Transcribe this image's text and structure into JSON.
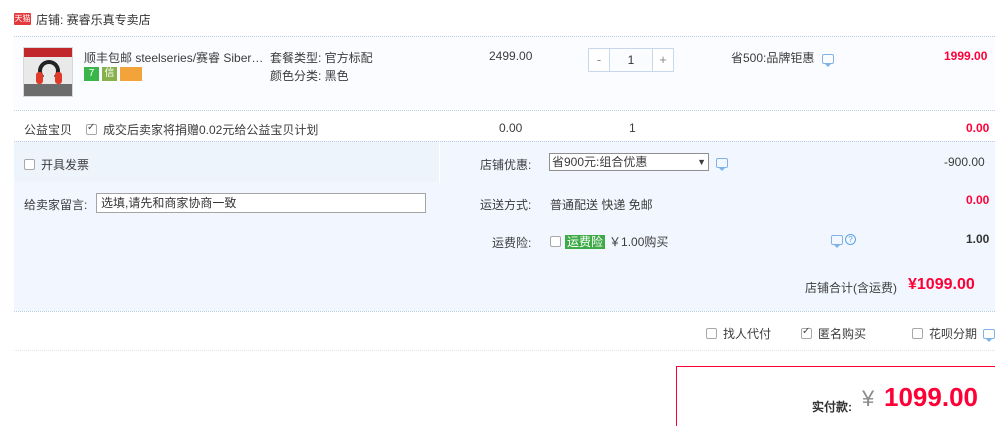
{
  "shop": {
    "badge": "天猫",
    "label": "店铺: 赛睿乐真专卖店"
  },
  "item": {
    "title": "顺丰包邮 steelseries/赛睿 Siberi...",
    "attr_package": "套餐类型: 官方标配",
    "attr_color": "颜色分类: 黑色",
    "unit_price": "2499.00",
    "quantity": "1",
    "minus": "-",
    "plus": "+",
    "promo": "省500:品牌钜惠",
    "subtotal": "1999.00",
    "icons": [
      "7",
      "信",
      ""
    ]
  },
  "charity": {
    "label": "公益宝贝",
    "checkbox_text": "成交后卖家将捐赠0.02元给公益宝贝计划",
    "price": "0.00",
    "quantity": "1",
    "subtotal": "0.00"
  },
  "invoice": {
    "label": "开具发票"
  },
  "shop_discount": {
    "label": "店铺优惠:",
    "selected": "省900元:组合优惠",
    "amount": "-900.00"
  },
  "message": {
    "label": "给卖家留言:",
    "value": "选填,请先和商家协商一致"
  },
  "shipping": {
    "label": "运送方式:",
    "value": "普通配送 快递 免邮",
    "amount": "0.00"
  },
  "freight_insurance": {
    "label": "运费险:",
    "tag": "运费险",
    "price": "￥1.00购买",
    "amount": "1.00"
  },
  "shop_total": {
    "label": "店铺合计(含运费)",
    "value": "¥1099.00"
  },
  "options": {
    "proxy_pay": "找人代付",
    "anonymous": "匿名购买",
    "installment": "花呗分期"
  },
  "payment": {
    "label": "实付款:",
    "yen": "¥",
    "value": "1099.00"
  },
  "colors": {
    "accent": "#ff0036",
    "band": "#f2f7ff"
  }
}
